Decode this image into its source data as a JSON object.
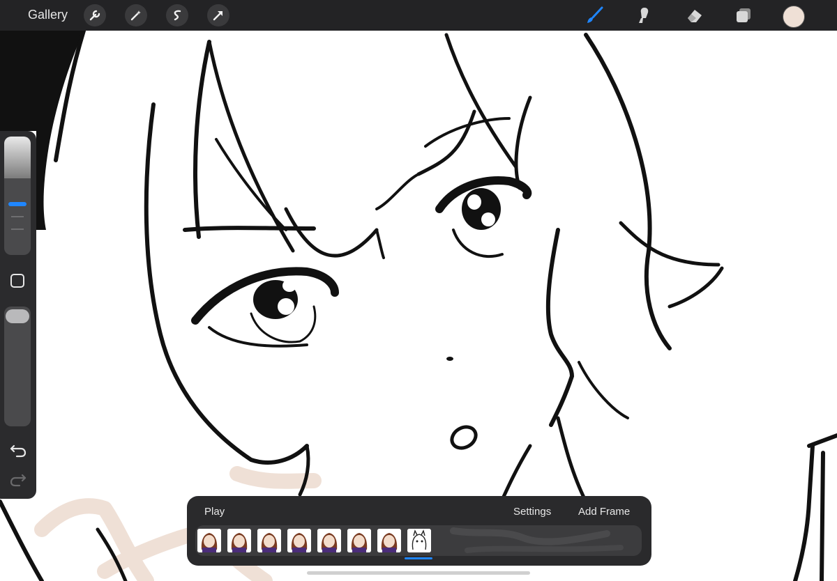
{
  "toolbar": {
    "gallery_label": "Gallery",
    "left_tools": [
      "wrench-icon",
      "magic-wand-icon",
      "selection-s-icon",
      "transform-arrow-icon"
    ],
    "right_tools": [
      "brush-icon",
      "smudge-icon",
      "eraser-icon",
      "layers-icon"
    ],
    "active_tool": "brush-icon",
    "current_color": "#efe0d6",
    "accent_color": "#1f86ff"
  },
  "sidebar": {
    "controls": [
      "brush-size-slider",
      "modify-button",
      "opacity-slider",
      "undo-button",
      "redo-button"
    ]
  },
  "animation": {
    "play_label": "Play",
    "settings_label": "Settings",
    "add_frame_label": "Add Frame",
    "frames_count": 8,
    "selected_frame": 8
  },
  "canvas": {
    "stroke_color": "#111111",
    "skin_color": "#efe0d6"
  }
}
